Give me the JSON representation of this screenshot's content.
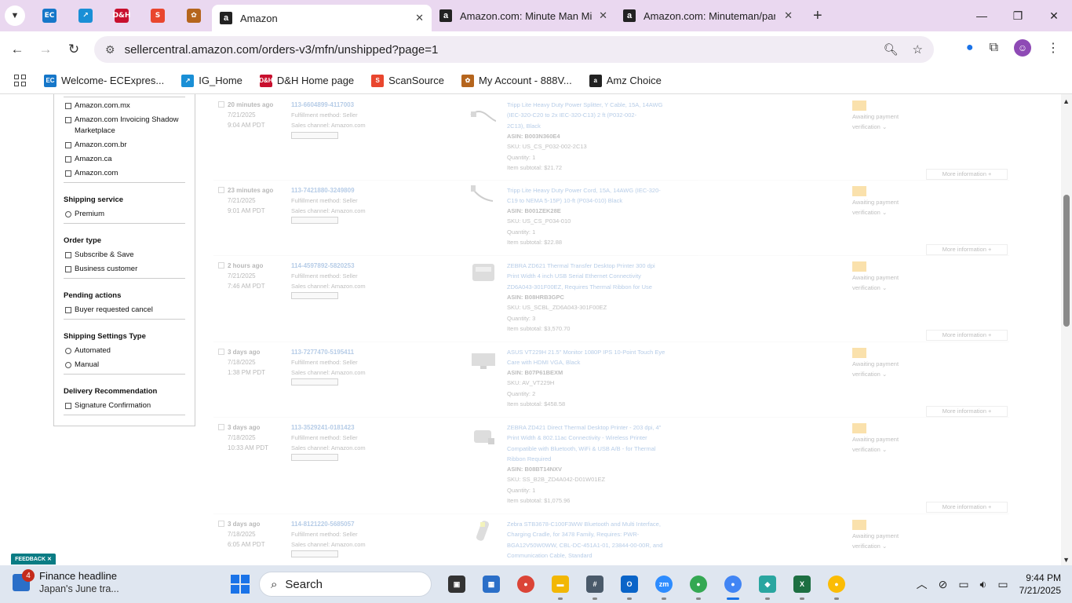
{
  "browser": {
    "tabs": [
      {
        "title": "Amazon",
        "active": true
      },
      {
        "title": "Amazon.com: Minute Man Min",
        "active": false
      },
      {
        "title": "Amazon.com: Minuteman/para",
        "active": false
      }
    ],
    "url": "sellercentral.amazon.com/orders-v3/mfn/unshipped?page=1",
    "bookmarks": [
      "Welcome- ECExpres...",
      "IG_Home",
      "D&H Home page",
      "ScanSource",
      "My Account - 888V...",
      "Amz Choice"
    ]
  },
  "filters": {
    "sales_channels": [
      "Amazon.com.mx",
      "Amazon.com Invoicing Shadow Marketplace",
      "Amazon.com.br",
      "Amazon.ca",
      "Amazon.com"
    ],
    "groups": [
      {
        "title": "Shipping service",
        "type": "radio",
        "options": [
          "Premium"
        ]
      },
      {
        "title": "Order type",
        "type": "check",
        "options": [
          "Subscribe & Save",
          "Business customer"
        ]
      },
      {
        "title": "Pending actions",
        "type": "check",
        "options": [
          "Buyer requested cancel"
        ]
      },
      {
        "title": "Shipping Settings Type",
        "type": "radio",
        "options": [
          "Automated",
          "Manual"
        ]
      },
      {
        "title": "Delivery Recommendation",
        "type": "check",
        "options": [
          "Signature Confirmation"
        ]
      }
    ]
  },
  "orders": [
    {
      "age": "20 minutes ago",
      "date": "7/21/2025",
      "time": "9:04 AM PDT",
      "order_id": "113-6604899-4117003",
      "fulfillment": "Fulfillment method: Seller",
      "channel": "Sales channel: Amazon.com",
      "product_lines": [
        "Tripp Lite Heavy Duty Power Splitter, Y Cable, 15A, 14AWG",
        "(IEC-320-C20 to 2x IEC-320-C13) 2 ft (P032-002-",
        "2C13), Black"
      ],
      "meta_lines": [
        "ASIN: B003N360E4",
        "SKU: US_CS_P032-002-2C13",
        "Quantity: 1",
        "Item subtotal: $21.72"
      ],
      "status": [
        "Awaiting payment",
        "verification"
      ],
      "more": "More information"
    },
    {
      "age": "23 minutes ago",
      "date": "7/21/2025",
      "time": "9:01 AM PDT",
      "order_id": "113-7421880-3249809",
      "fulfillment": "Fulfillment method: Seller",
      "channel": "Sales channel: Amazon.com",
      "product_lines": [
        "Tripp Lite Heavy Duty Power Cord, 15A, 14AWG (IEC-320-",
        "C19 to NEMA 5-15P) 10-ft (P034-010) Black"
      ],
      "meta_lines": [
        "ASIN: B001ZEK28E",
        "SKU: US_CS_P034-010",
        "Quantity: 1",
        "Item subtotal: $22.88"
      ],
      "status": [
        "Awaiting payment",
        "verification"
      ],
      "more": "More information"
    },
    {
      "age": "2 hours ago",
      "date": "7/21/2025",
      "time": "7:46 AM PDT",
      "order_id": "114-4597892-5820253",
      "fulfillment": "Fulfillment method: Seller",
      "channel": "Sales channel: Amazon.com",
      "product_lines": [
        "ZEBRA ZD621 Thermal Transfer Desktop Printer 300 dpi",
        "Print Width 4 inch USB Serial Ethernet Connectivity",
        "ZD6A043-301F00EZ, Requires Thermal Ribbon for Use"
      ],
      "meta_lines": [
        "ASIN: B08HRB3GPC",
        "SKU: US_SCBL_ZD6A043-301F00EZ",
        "Quantity: 3",
        "Item subtotal: $3,570.70"
      ],
      "status": [
        "Awaiting payment",
        "verification"
      ],
      "more": "More information"
    },
    {
      "age": "3 days ago",
      "date": "7/18/2025",
      "time": "1:38 PM PDT",
      "order_id": "113-7277470-5195411",
      "fulfillment": "Fulfillment method: Seller",
      "channel": "Sales channel: Amazon.com",
      "product_lines": [
        "ASUS VT229H 21.5\" Monitor 1080P IPS 10-Point Touch Eye",
        "Care with HDMI VGA, Black"
      ],
      "meta_lines": [
        "ASIN: B07P61BEXM",
        "SKU: AV_VT229H",
        "Quantity: 2",
        "Item subtotal: $458.58"
      ],
      "status": [
        "Awaiting payment",
        "verification"
      ],
      "more": "More information"
    },
    {
      "age": "3 days ago",
      "date": "7/18/2025",
      "time": "10:33 AM PDT",
      "order_id": "113-3529241-0181423",
      "fulfillment": "Fulfillment method: Seller",
      "channel": "Sales channel: Amazon.com",
      "product_lines": [
        "ZEBRA ZD421 Direct Thermal Desktop Printer - 203 dpi, 4\"",
        "Print Width & 802.11ac Connectivity - Wireless Printer",
        "Compatible with Bluetooth, WiFi & USB A/B - for Thermal",
        "Ribbon Required"
      ],
      "meta_lines": [
        "ASIN: B08BT14NXV",
        "SKU: SS_B2B_ZD4A042-D01W01EZ",
        "Quantity: 1",
        "Item subtotal: $1,075.96"
      ],
      "status": [
        "Awaiting payment",
        "verification"
      ],
      "more": "More information"
    },
    {
      "age": "3 days ago",
      "date": "7/18/2025",
      "time": "6:05 AM PDT",
      "order_id": "114-8121220-5685057",
      "fulfillment": "Fulfillment method: Seller",
      "channel": "Sales channel: Amazon.com",
      "product_lines": [
        "Zebra STB3678-C100F3WW Bluetooth and Multi Interface,",
        "Charging Cradle, for 3478 Family, Requires: PWR-",
        "BGA12V50W0WW, CBL-DC-451A1-01, 23844-00-00R, and",
        "Communication Cable, Standard"
      ],
      "meta_lines": [],
      "status": [
        "Awaiting payment",
        "verification"
      ],
      "more": ""
    }
  ],
  "feedback": "FEEDBACK",
  "taskbar": {
    "news_badge": "4",
    "news_title": "Finance headline",
    "news_sub": "Japan's June tra...",
    "search_label": "Search",
    "time": "9:44 PM",
    "date": "7/21/2025"
  }
}
